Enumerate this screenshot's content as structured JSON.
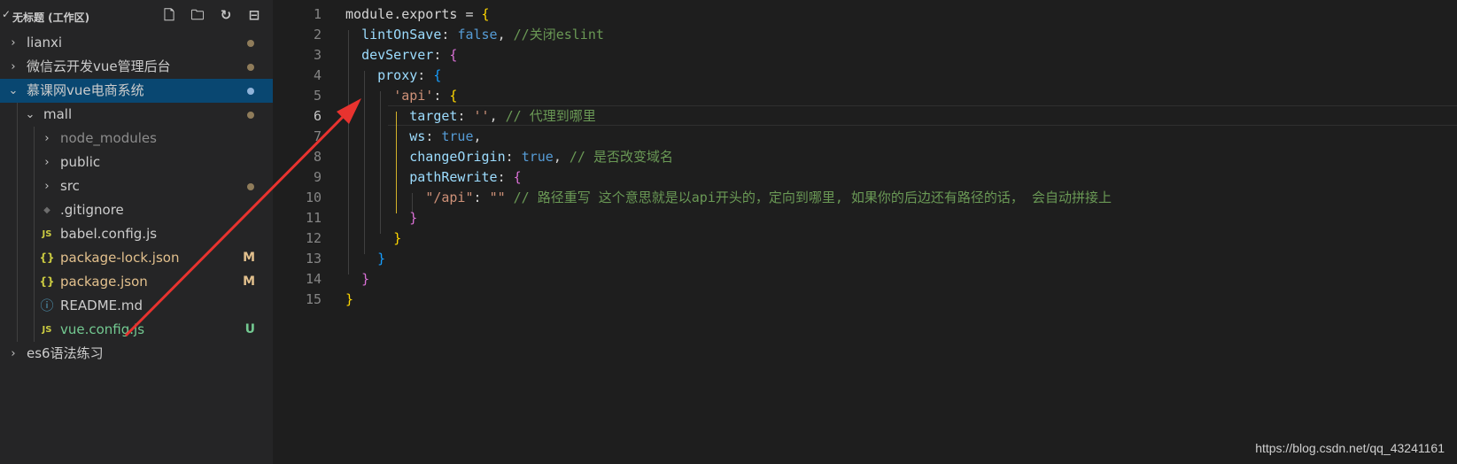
{
  "explorer": {
    "workspace_title": "无标题 (工作区)",
    "action_icons": [
      "new-file-icon",
      "new-folder-icon",
      "refresh-icon",
      "collapse-all-icon"
    ],
    "items": [
      {
        "label": "lianxi",
        "type": "folder",
        "expanded": false,
        "depth": 0,
        "modified_dot": true
      },
      {
        "label": "微信云开发vue管理后台",
        "type": "folder",
        "expanded": false,
        "depth": 0,
        "modified_dot": true
      },
      {
        "label": "慕课网vue电商系统",
        "type": "folder",
        "expanded": true,
        "depth": 0,
        "modified_dot": true,
        "selected": true
      },
      {
        "label": "mall",
        "type": "folder",
        "expanded": true,
        "depth": 1,
        "modified_dot": true
      },
      {
        "label": "node_modules",
        "type": "folder",
        "expanded": false,
        "depth": 2,
        "dimmed": true
      },
      {
        "label": "public",
        "type": "folder",
        "expanded": false,
        "depth": 2
      },
      {
        "label": "src",
        "type": "folder",
        "expanded": false,
        "depth": 2,
        "modified_dot": true
      },
      {
        "label": ".gitignore",
        "type": "file",
        "icon": "git-icon",
        "depth": 2
      },
      {
        "label": "babel.config.js",
        "type": "file",
        "icon": "js-icon",
        "icon_text": "JS",
        "depth": 2
      },
      {
        "label": "package-lock.json",
        "type": "file",
        "icon": "json-icon",
        "icon_text": "{}",
        "depth": 2,
        "status": "M"
      },
      {
        "label": "package.json",
        "type": "file",
        "icon": "json-icon",
        "icon_text": "{}",
        "depth": 2,
        "status": "M"
      },
      {
        "label": "README.md",
        "type": "file",
        "icon": "info-icon",
        "icon_text": "ⓘ",
        "depth": 2
      },
      {
        "label": "vue.config.js",
        "type": "file",
        "icon": "js-icon",
        "icon_text": "JS",
        "depth": 2,
        "status": "U"
      },
      {
        "label": "es6语法练习",
        "type": "folder",
        "expanded": false,
        "depth": 0
      }
    ]
  },
  "colors": {
    "modified": "#e2c08d",
    "untracked": "#73c991",
    "selected_bg": "#094771",
    "js_icon": "#cbcb41",
    "json_icon": "#cbcb41",
    "info_icon": "#519aba",
    "arrow": "#e8332f"
  },
  "editor": {
    "lines": [
      {
        "n": "1",
        "tokens": [
          [
            "c-id",
            "module"
          ],
          [
            "c-id",
            "."
          ],
          [
            "c-id",
            "exports"
          ],
          [
            "c-id",
            " = "
          ],
          [
            "c-b1",
            "{"
          ]
        ]
      },
      {
        "n": "2",
        "tokens": [
          [
            "c-id",
            "  "
          ],
          [
            "c-prop",
            "lintOnSave"
          ],
          [
            "c-id",
            ": "
          ],
          [
            "c-kw",
            "false"
          ],
          [
            "c-id",
            ", "
          ],
          [
            "c-cmt",
            "//关闭eslint"
          ]
        ]
      },
      {
        "n": "3",
        "tokens": [
          [
            "c-id",
            "  "
          ],
          [
            "c-prop",
            "devServer"
          ],
          [
            "c-id",
            ": "
          ],
          [
            "c-b2",
            "{"
          ]
        ]
      },
      {
        "n": "4",
        "tokens": [
          [
            "c-id",
            "    "
          ],
          [
            "c-prop",
            "proxy"
          ],
          [
            "c-id",
            ": "
          ],
          [
            "c-b3",
            "{"
          ]
        ]
      },
      {
        "n": "5",
        "tokens": [
          [
            "c-id",
            "      "
          ],
          [
            "c-str",
            "'api'"
          ],
          [
            "c-id",
            ": "
          ],
          [
            "c-b1",
            "{"
          ]
        ]
      },
      {
        "n": "6",
        "tokens": [
          [
            "c-id",
            "        "
          ],
          [
            "c-prop",
            "target"
          ],
          [
            "c-id",
            ": "
          ],
          [
            "c-str",
            "''"
          ],
          [
            "c-id",
            ", "
          ],
          [
            "c-cmt",
            "// 代理到哪里"
          ]
        ]
      },
      {
        "n": "7",
        "tokens": [
          [
            "c-id",
            "        "
          ],
          [
            "c-prop",
            "ws"
          ],
          [
            "c-id",
            ": "
          ],
          [
            "c-kw",
            "true"
          ],
          [
            "c-id",
            ","
          ]
        ]
      },
      {
        "n": "8",
        "tokens": [
          [
            "c-id",
            "        "
          ],
          [
            "c-prop",
            "changeOrigin"
          ],
          [
            "c-id",
            ": "
          ],
          [
            "c-kw",
            "true"
          ],
          [
            "c-id",
            ", "
          ],
          [
            "c-cmt",
            "// 是否改变域名"
          ]
        ]
      },
      {
        "n": "9",
        "tokens": [
          [
            "c-id",
            "        "
          ],
          [
            "c-prop",
            "pathRewrite"
          ],
          [
            "c-id",
            ": "
          ],
          [
            "c-b2",
            "{"
          ]
        ]
      },
      {
        "n": "10",
        "tokens": [
          [
            "c-id",
            "          "
          ],
          [
            "c-str",
            "\"/api\""
          ],
          [
            "c-id",
            ": "
          ],
          [
            "c-str",
            "\"\""
          ],
          [
            "c-id",
            " "
          ],
          [
            "c-cmt",
            "// 路径重写 这个意思就是以api开头的，定向到哪里, 如果你的后边还有路径的话， 会自动拼接上"
          ]
        ]
      },
      {
        "n": "11",
        "tokens": [
          [
            "c-id",
            "        "
          ],
          [
            "c-b2",
            "}"
          ]
        ]
      },
      {
        "n": "12",
        "tokens": [
          [
            "c-id",
            "      "
          ],
          [
            "c-b1",
            "}"
          ]
        ]
      },
      {
        "n": "13",
        "tokens": [
          [
            "c-id",
            "    "
          ],
          [
            "c-b3",
            "}"
          ]
        ]
      },
      {
        "n": "14",
        "tokens": [
          [
            "c-id",
            "  "
          ],
          [
            "c-b2",
            "}"
          ]
        ]
      },
      {
        "n": "15",
        "tokens": [
          [
            "c-b1",
            "}"
          ]
        ]
      }
    ]
  },
  "watermark": "https://blog.csdn.net/qq_43241161"
}
